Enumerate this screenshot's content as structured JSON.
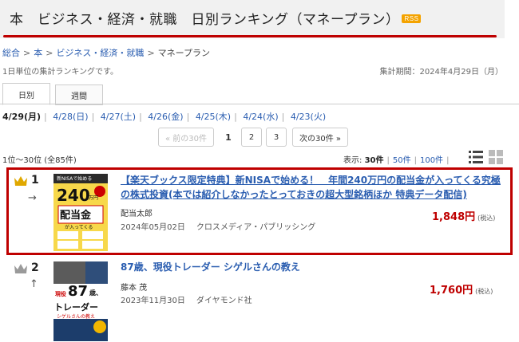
{
  "header": {
    "title": "本　ビジネス・経済・就職　日別ランキング（マネープラン）",
    "rss": "RSS"
  },
  "breadcrumb": {
    "items": [
      "総合",
      "本",
      "ビジネス・経済・就職"
    ],
    "current": "マネープラン",
    "separator": ">"
  },
  "description": "1日単位の集計ランキングです。",
  "period": "集計期間：2024年4月29日（月）",
  "tabs": [
    {
      "label": "日別",
      "active": true
    },
    {
      "label": "週間",
      "active": false
    }
  ],
  "dates": [
    "4/29(月)",
    "4/28(日)",
    "4/27(土)",
    "4/26(金)",
    "4/25(木)",
    "4/24(水)",
    "4/23(火)"
  ],
  "date_separator": "|",
  "pager": {
    "prev": "« 前の30件",
    "current": "1",
    "pages": [
      "2",
      "3"
    ],
    "next": "次の30件 »"
  },
  "count": "1位～30位 (全85件)",
  "display": {
    "label": "表示:",
    "current": "30件",
    "options": [
      "50件",
      "100件"
    ]
  },
  "colors": {
    "accent": "#bf0000",
    "link": "#2a5db0",
    "gold": "#e0a800",
    "silver": "#9a9a9a"
  },
  "items": [
    {
      "rank": "1",
      "trend": "→",
      "crown": "gold-crown-icon",
      "title": "【楽天ブックス限定特典】新NISAで始める！　年間240万円の配当金が入ってくる究極の株式投資(本では紹介しなかったとっておきの超大型銘柄ほか 特典データ配信)",
      "author": "配当太郎",
      "date": "2024年05月02日",
      "publisher": "クロスメディア・パブリッシング",
      "price": "1,848円",
      "tax": "(税込)",
      "cover_text": {
        "top": "新NISAで始める",
        "num": "240",
        "unit": "万円",
        "main": "配当金",
        "sub": "が入ってくる"
      }
    },
    {
      "rank": "2",
      "trend": "↑",
      "crown": "silver-crown-icon",
      "title": "87歳、現役トレーダー シゲルさんの教え",
      "author": "藤本 茂",
      "date": "2023年11月30日",
      "publisher": "ダイヤモンド社",
      "price": "1,760円",
      "tax": "(税込)",
      "cover_text": {
        "age": "87",
        "sai": "歳、",
        "kicker": "現役",
        "main": "トレーダー",
        "sub": "シゲルさんの教え"
      }
    }
  ]
}
